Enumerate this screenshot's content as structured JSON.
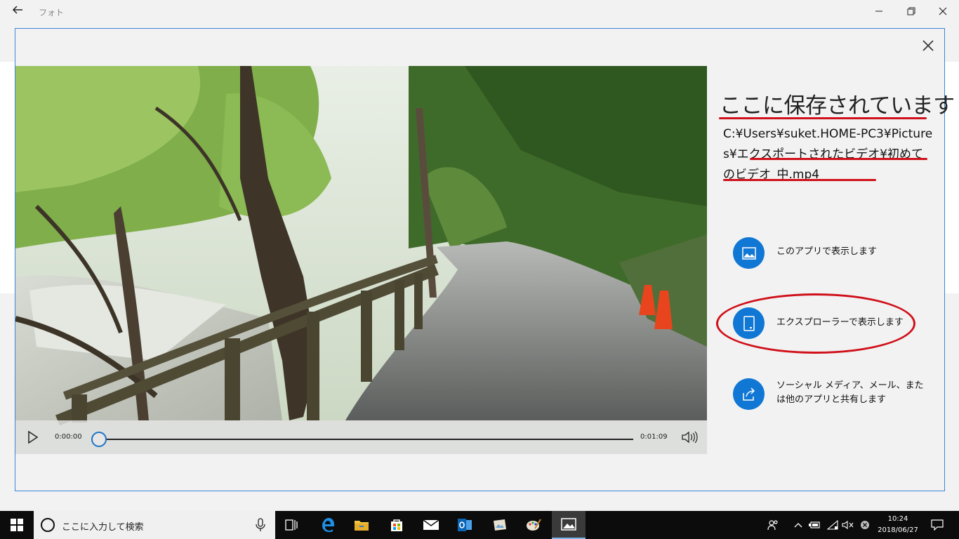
{
  "app": {
    "title": "フォト"
  },
  "dialog": {
    "heading": "ここに保存されています",
    "path": "C:¥Users¥suket.HOME-PC3¥Pictures¥エクスポートされたビデオ¥初めてのビデオ_中.mp4",
    "actions": [
      {
        "label": "このアプリで表示します",
        "icon": "image-icon"
      },
      {
        "label": "エクスプローラーで表示します",
        "icon": "tablet-icon"
      },
      {
        "label": "ソーシャル メディア、メール、または他のアプリと共有します",
        "icon": "share-icon"
      }
    ]
  },
  "player": {
    "current_time": "0:00:00",
    "total_time": "0:01:09",
    "progress": 0
  },
  "taskbar": {
    "search_placeholder": "ここに入力して検索",
    "time": "10:24",
    "date": "2018/06/27"
  },
  "colors": {
    "accent": "#1177d4",
    "annotation_red": "#d0101a",
    "dialog_border": "#3a86d6",
    "taskbar": "#0c0c0c"
  }
}
